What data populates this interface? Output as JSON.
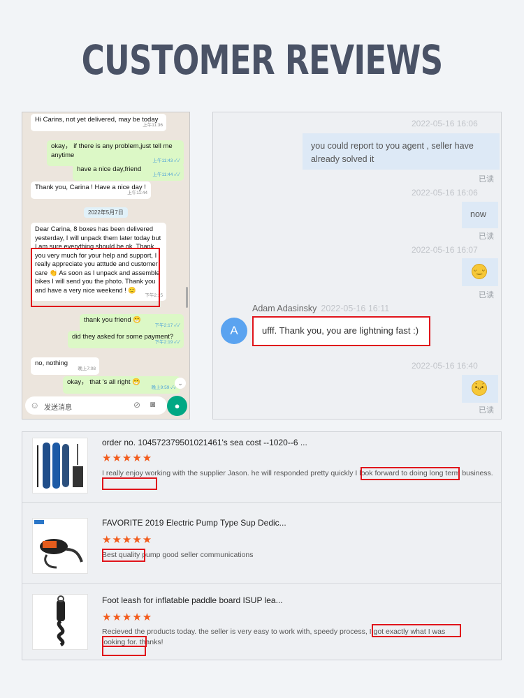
{
  "page": {
    "title": "CUSTOMER REVIEWS"
  },
  "whatsapp": {
    "messages": [
      {
        "text": "Hi Carins, not yet delivered, may be today",
        "time": "上午11:36"
      },
      {
        "text": "okay， if there is any problem,just tell me anytime",
        "time": "上午11:43 ✓✓"
      },
      {
        "text": "have a nice day,friend",
        "time": "上午11:44 ✓✓"
      },
      {
        "text": "Thank you, Carina ! Have a nice day !",
        "time": "上午11:44"
      },
      {
        "text": "Dear Carina, 8 boxes has been delivered yesterday, I will unpack them later today but I am sure everything should be ok. Thank you very much for your help and support, I really appreciate you atttude and customer care 👏 As soon as I unpack and assemble bikes I will send you the photo. Thank you and have a very nice weekend ! 🙂",
        "time": "下午2:15"
      },
      {
        "text": "thank you friend 😁",
        "time": "下午2:17 ✓✓"
      },
      {
        "text": "did they asked for some payment?",
        "time": "下午2:19 ✓✓"
      },
      {
        "text": "no, nothing",
        "time": "晚上7:08"
      },
      {
        "text": "okay， that 's all right 😁",
        "time": "晚上9:59 ✓✓"
      }
    ],
    "date_chip": "2022年5月7日",
    "input_placeholder": "发送消息",
    "icons": {
      "emoji": "smile-icon",
      "attach": "paperclip-icon",
      "camera": "camera-icon",
      "mic": "mic-icon"
    }
  },
  "chat": {
    "entries": [
      {
        "time": "2022-05-16 16:06",
        "text": "you could report to you agent , seller have already solved it",
        "status": "已读"
      },
      {
        "time": "2022-05-16 16:06",
        "text": "now",
        "status": "已读"
      },
      {
        "time": "2022-05-16 16:07",
        "text": "",
        "status": "已读"
      },
      {
        "time": "2022-05-16 16:40",
        "text": "",
        "status": "已读"
      }
    ],
    "incoming": {
      "name": "Adam Adasinsky",
      "time": "2022-05-16 16:11",
      "avatar": "A",
      "text": "ufff. Thank you, you are lightning fast :)"
    }
  },
  "reviews": [
    {
      "title": "order no. 104572379501021461's sea cost --1020--6 ...",
      "stars": "★★★★★",
      "rating": 5,
      "text": "I really enjoy working with the supplier Jason. he will responded pretty quickly I look forward to doing long term business."
    },
    {
      "title": "FAVORITE 2019 Electric Pump Type Sup Dedic...",
      "stars": "★★★★★",
      "rating": 5,
      "text": "Best quality pump good seller communications"
    },
    {
      "title": "Foot leash for inflatable paddle board ISUP lea...",
      "stars": "★★★★★",
      "rating": 5,
      "text": "Recieved the products today. the seller is very easy to work with, speedy process, I got exactly what  I was looking for. thanks!"
    }
  ],
  "colors": {
    "highlight": "#e0141b",
    "star": "#f25b1c",
    "title": "#4a5266",
    "wa_out": "#dcf8c6",
    "avatar": "#5aa3f0"
  }
}
